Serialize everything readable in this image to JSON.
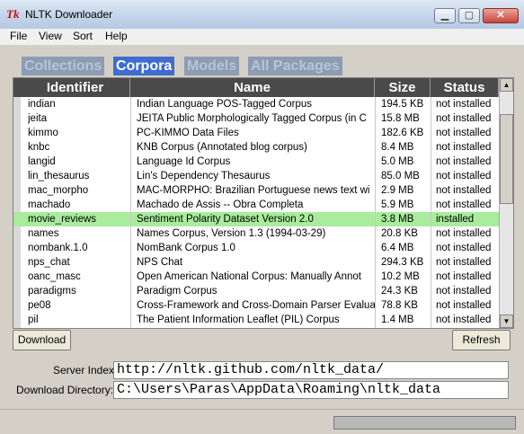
{
  "window": {
    "title": "NLTK Downloader",
    "app_icon": "tk-icon"
  },
  "menu": {
    "file": "File",
    "view": "View",
    "sort": "Sort",
    "help": "Help"
  },
  "tabs": {
    "collections": "Collections",
    "corpora": "Corpora",
    "models": "Models",
    "packages": "All Packages"
  },
  "table": {
    "headers": {
      "id": "Identifier",
      "name": "Name",
      "size": "Size",
      "status": "Status"
    },
    "rows": [
      {
        "id": "indian",
        "name": "Indian Language POS-Tagged Corpus",
        "size": "194.5 KB",
        "status": "not installed"
      },
      {
        "id": "jeita",
        "name": "JEITA Public Morphologically Tagged Corpus (in C",
        "size": "15.8 MB",
        "status": "not installed"
      },
      {
        "id": "kimmo",
        "name": "PC-KIMMO Data Files",
        "size": "182.6 KB",
        "status": "not installed"
      },
      {
        "id": "knbc",
        "name": "KNB Corpus (Annotated blog corpus)",
        "size": "8.4 MB",
        "status": "not installed"
      },
      {
        "id": "langid",
        "name": "Language Id Corpus",
        "size": "5.0 MB",
        "status": "not installed"
      },
      {
        "id": "lin_thesaurus",
        "name": "Lin's Dependency Thesaurus",
        "size": "85.0 MB",
        "status": "not installed"
      },
      {
        "id": "mac_morpho",
        "name": "MAC-MORPHO: Brazilian Portuguese news text wi",
        "size": "2.9 MB",
        "status": "not installed"
      },
      {
        "id": "machado",
        "name": "Machado de Assis -- Obra Completa",
        "size": "5.9 MB",
        "status": "not installed"
      },
      {
        "id": "movie_reviews",
        "name": "Sentiment Polarity Dataset Version 2.0",
        "size": "3.8 MB",
        "status": "installed"
      },
      {
        "id": "names",
        "name": "Names Corpus, Version 1.3 (1994-03-29)",
        "size": "20.8 KB",
        "status": "not installed"
      },
      {
        "id": "nombank.1.0",
        "name": "NomBank Corpus 1.0",
        "size": "6.4 MB",
        "status": "not installed"
      },
      {
        "id": "nps_chat",
        "name": "NPS Chat",
        "size": "294.3 KB",
        "status": "not installed"
      },
      {
        "id": "oanc_masc",
        "name": "Open American National Corpus: Manually Annot",
        "size": "10.2 MB",
        "status": "not installed"
      },
      {
        "id": "paradigms",
        "name": "Paradigm Corpus",
        "size": "24.3 KB",
        "status": "not installed"
      },
      {
        "id": "pe08",
        "name": "Cross-Framework and Cross-Domain Parser Evalua",
        "size": "78.8 KB",
        "status": "not installed"
      },
      {
        "id": "pil",
        "name": "The Patient Information Leaflet (PIL) Corpus",
        "size": "1.4 MB",
        "status": "not installed"
      }
    ]
  },
  "buttons": {
    "download": "Download",
    "refresh": "Refresh"
  },
  "fields": {
    "server_label": "Server Index:",
    "server_value": "http://nltk.github.com/nltk_data/",
    "dir_label": "Download Directory:",
    "dir_value": "C:\\Users\\Paras\\AppData\\Roaming\\nltk_data"
  },
  "progress": {
    "fraction": 0
  }
}
